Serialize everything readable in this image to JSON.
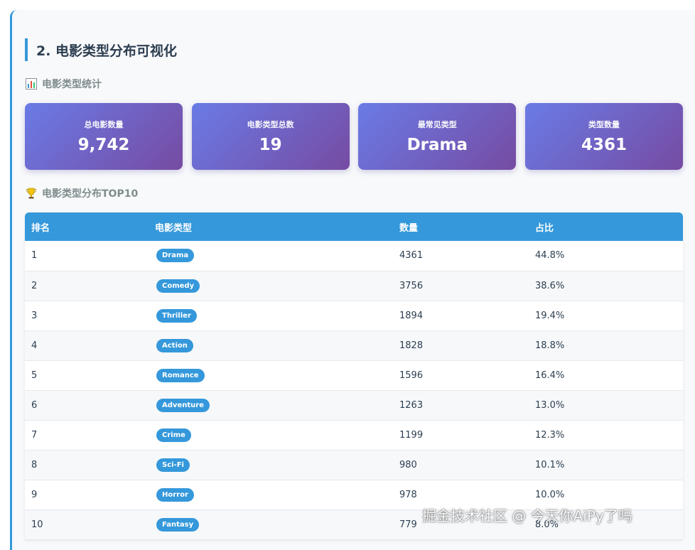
{
  "section": {
    "title": "2. 电影类型分布可视化"
  },
  "stats_section": {
    "title": "电影类型统计",
    "icon": "bar-chart-icon",
    "cards": [
      {
        "label": "总电影数量",
        "value": "9,742"
      },
      {
        "label": "电影类型总数",
        "value": "19"
      },
      {
        "label": "最常见类型",
        "value": "Drama"
      },
      {
        "label": "类型数量",
        "value": "4361"
      }
    ]
  },
  "top10_section": {
    "title": "电影类型分布TOP10",
    "icon": "trophy-icon"
  },
  "table": {
    "headers": {
      "rank": "排名",
      "genre": "电影类型",
      "count": "数量",
      "ratio": "占比"
    },
    "rows": [
      {
        "rank": "1",
        "genre": "Drama",
        "count": "4361",
        "ratio": "44.8%"
      },
      {
        "rank": "2",
        "genre": "Comedy",
        "count": "3756",
        "ratio": "38.6%"
      },
      {
        "rank": "3",
        "genre": "Thriller",
        "count": "1894",
        "ratio": "19.4%"
      },
      {
        "rank": "4",
        "genre": "Action",
        "count": "1828",
        "ratio": "18.8%"
      },
      {
        "rank": "5",
        "genre": "Romance",
        "count": "1596",
        "ratio": "16.4%"
      },
      {
        "rank": "6",
        "genre": "Adventure",
        "count": "1263",
        "ratio": "13.0%"
      },
      {
        "rank": "7",
        "genre": "Crime",
        "count": "1199",
        "ratio": "12.3%"
      },
      {
        "rank": "8",
        "genre": "Sci-Fi",
        "count": "980",
        "ratio": "10.1%"
      },
      {
        "rank": "9",
        "genre": "Horror",
        "count": "978",
        "ratio": "10.0%"
      },
      {
        "rank": "10",
        "genre": "Fantasy",
        "count": "779",
        "ratio": "8.0%"
      }
    ]
  },
  "watermark": "掘金技术社区 @ 今天你AiPy了吗",
  "colors": {
    "accent": "#3498db",
    "card_gradient_start": "#6a7be6",
    "card_gradient_end": "#764ba2",
    "title_text": "#2c3e50",
    "subtitle_text": "#7f8c8d"
  }
}
